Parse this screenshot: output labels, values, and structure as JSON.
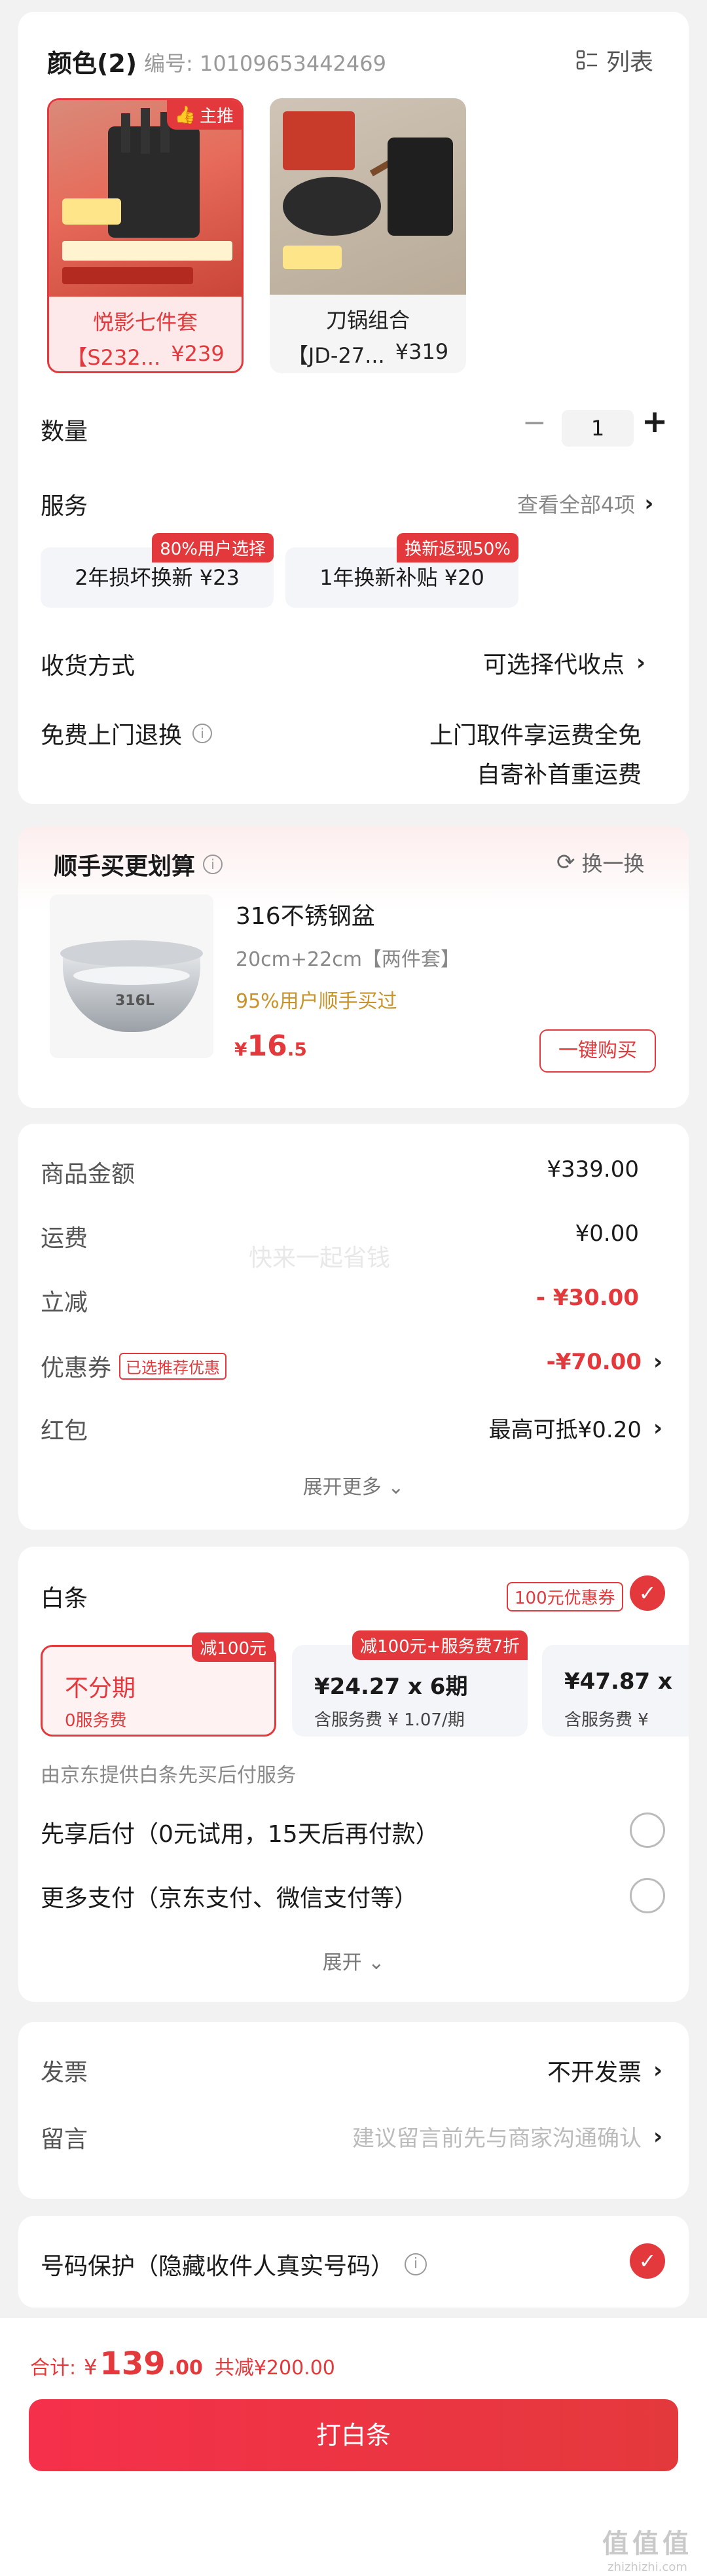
{
  "color_section": {
    "title": "颜色(2)",
    "code": "编号: 10109653442469",
    "list_label": "列表",
    "main_badge": "主推",
    "options": [
      {
        "name": "悦影七件套",
        "sub": "【S232...",
        "price": "¥239",
        "selected": true
      },
      {
        "name": "刀锅组合",
        "sub": "【JD-27...",
        "price": "¥319",
        "selected": false
      }
    ]
  },
  "quantity": {
    "label": "数量",
    "value": "1",
    "minus": "−",
    "plus": "+"
  },
  "service": {
    "label": "服务",
    "view_all": "查看全部4项",
    "options": [
      {
        "badge": "80%用户选择",
        "text": "2年损坏换新 ¥23"
      },
      {
        "badge": "换新返现50%",
        "text": "1年换新补贴 ¥20"
      }
    ]
  },
  "delivery": {
    "label": "收货方式",
    "value": "可选择代收点"
  },
  "free_return": {
    "label": "免费上门退换",
    "line1": "上门取件享运费全免",
    "line2": "自寄补首重运费"
  },
  "addon": {
    "title": "顺手买更划算",
    "refresh": "换一换",
    "product_name": "316不锈钢盆",
    "product_spec": "20cm+22cm【两件套】",
    "product_stat": "95%用户顺手买过",
    "price_symbol": "¥",
    "price_int": "16",
    "price_dec": ".5",
    "buy_button": "一键购买",
    "img_text": "316L"
  },
  "price_summary": {
    "rows": [
      {
        "label": "商品金额",
        "value": "¥339.00"
      },
      {
        "label": "运费",
        "value": "¥0.00"
      },
      {
        "label": "立减",
        "value": "- ¥30.00"
      },
      {
        "label": "优惠券",
        "tag": "已选推荐优惠",
        "value": "-¥70.00"
      },
      {
        "label": "红包",
        "value": "最高可抵¥0.20"
      }
    ],
    "expand": "展开更多"
  },
  "baitiao": {
    "label": "白条",
    "coupon": "100元优惠券",
    "plans": [
      {
        "badge": "减100元",
        "title": "不分期",
        "sub": "0服务费"
      },
      {
        "badge": "减100元+服务费7折",
        "title": "¥24.27 x 6期",
        "sub": "含服务费 ¥ 1.07/期"
      },
      {
        "title": "¥47.87 x",
        "sub": "含服务费 ¥"
      }
    ],
    "provider_note": "由京东提供白条先买后付服务",
    "pay_later": "先享后付（0元试用，15天后再付款）",
    "more_pay": "更多支付（京东支付、微信支付等）",
    "expand": "展开"
  },
  "invoice": {
    "label": "发票",
    "value": "不开发票"
  },
  "note": {
    "label": "留言",
    "placeholder": "建议留言前先与商家沟通确认"
  },
  "privacy": {
    "label": "号码保护（隐藏收件人真实号码）"
  },
  "footer": {
    "total_label": "合计:",
    "symbol": "¥",
    "total_int": "139",
    "total_dec": ".00",
    "saved": "共减¥200.00",
    "pay_button": "打白条"
  },
  "watermark": "快来一起省钱",
  "corner_logo": "值值值",
  "corner_url": "zhizhizhi.com",
  "colors": {
    "accent": "#e4393c",
    "gold": "#c8932a"
  }
}
